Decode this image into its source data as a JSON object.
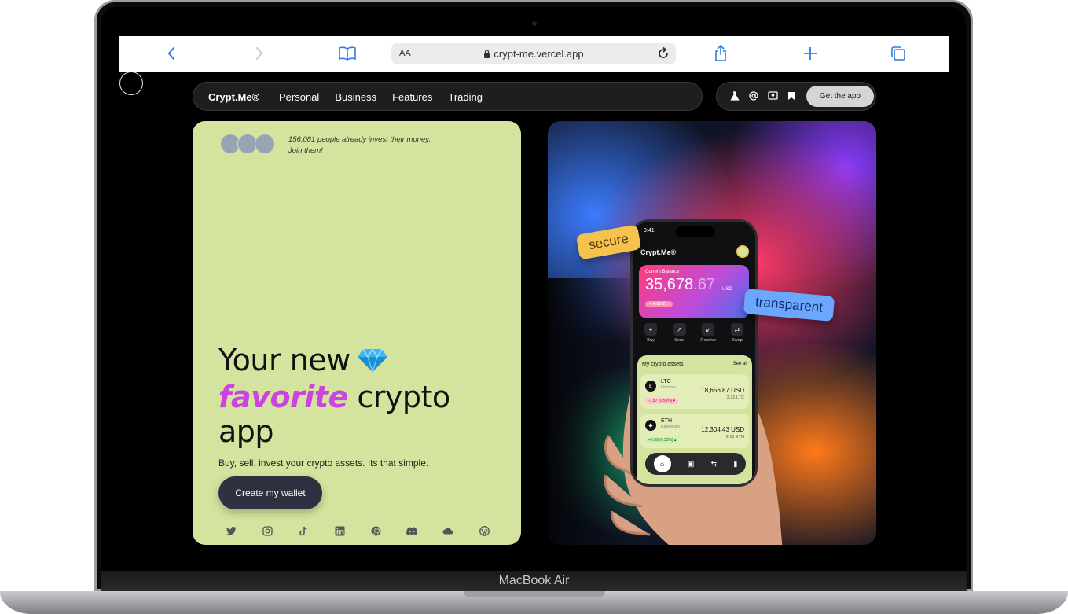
{
  "browser": {
    "text_size_label": "AA",
    "url": "crypt-me.vercel.app"
  },
  "device": {
    "model_label": "MacBook Air"
  },
  "nav": {
    "brand": "Crypt.Me®",
    "links": [
      "Personal",
      "Business",
      "Features",
      "Trading"
    ],
    "icons": [
      "flask-icon",
      "at-sign-icon",
      "image-icon",
      "bookmark-icon"
    ],
    "cta": "Get the app"
  },
  "hero_left": {
    "social_proof_line1": "156,081 people already invest their money.",
    "social_proof_line2": "Join them!",
    "headline_part1": "Your new",
    "headline_highlight": "favorite",
    "headline_part2": "crypto",
    "headline_part3": "app",
    "subtitle": "Buy, sell, invest your crypto assets. Its that simple.",
    "cta": "Create my wallet",
    "socials": [
      "twitter-icon",
      "instagram-icon",
      "tiktok-icon",
      "linkedin-icon",
      "github-icon",
      "discord-icon",
      "cloud-icon",
      "wordpress-icon"
    ],
    "accent_color": "#cc44e0",
    "panel_color": "#d4e39e"
  },
  "hero_right": {
    "tag_secure": "secure",
    "tag_transparent": "transparent"
  },
  "phone": {
    "time": "9:41",
    "brand": "Crypt.Me®",
    "balance_label": "Current Balance",
    "balance_whole": "35,678",
    "balance_cents": ".67",
    "balance_currency": "USD",
    "balance_change": "+ 4.68(2 ↑",
    "actions": [
      "Buy",
      "Send",
      "Receive",
      "Swap"
    ],
    "assets_title": "My crypto assets",
    "assets_see_all": "See all",
    "assets": [
      {
        "symbol": "LTC",
        "name": "Litecoin",
        "value": "18,656.87 USD",
        "qty": "3.21 LTC",
        "change": "-1.87 (0.53%) ▾",
        "direction": "neg"
      },
      {
        "symbol": "ETH",
        "name": "Ethereum",
        "value": "12,304.43 USD",
        "qty": "2.15 ETH",
        "change": "+6.39 (0.53%) ▴",
        "direction": "pos"
      }
    ]
  }
}
